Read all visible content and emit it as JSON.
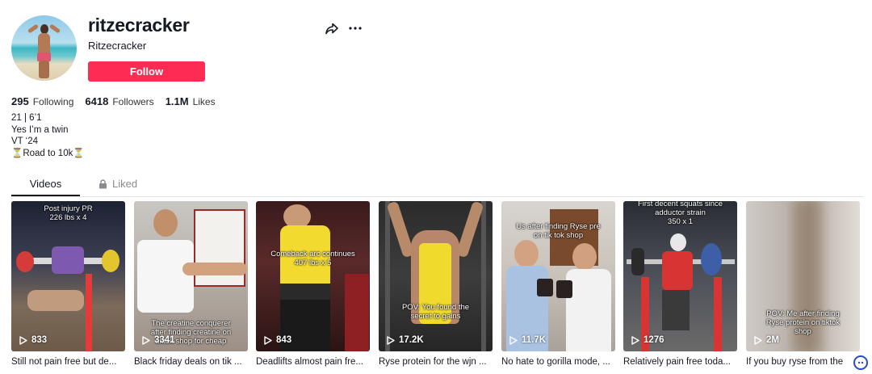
{
  "profile": {
    "username": "ritzecracker",
    "nickname": "Ritzecracker",
    "follow_label": "Follow"
  },
  "stats": {
    "following_count": "295",
    "following_label": "Following",
    "followers_count": "6418",
    "followers_label": "Followers",
    "likes_count": "1.1M",
    "likes_label": "Likes"
  },
  "bio": {
    "lines": [
      "21 | 6’1",
      "Yes I’m a twin",
      "VT ‘24",
      "⏳Road to 10k⏳"
    ]
  },
  "tabs": {
    "videos_label": "Videos",
    "liked_label": "Liked"
  },
  "videos": [
    {
      "overlay_top": "Post injury PR\n226 lbs x 4",
      "overlay_mid": "",
      "views": "833",
      "caption": "Still not pain free but de..."
    },
    {
      "overlay_top": "",
      "overlay_mid": "The creatine conquerer\nafter finding creatine on\ntiktok shop for cheap",
      "views": "3341",
      "caption": "Black friday deals on tik ..."
    },
    {
      "overlay_top": "",
      "overlay_mid": "Comeback arc continues\n407 lbs x 5",
      "views": "843",
      "caption": "Deadlifts almost pain fre..."
    },
    {
      "overlay_top": "",
      "overlay_mid": "POV: You found the\nsecret to gains",
      "views": "17.2K",
      "caption": "Ryse protein for the wjn ..."
    },
    {
      "overlay_top": "Us after finding Ryse pre\non tik tok shop",
      "overlay_mid": "",
      "views": "11.7K",
      "caption": "No hate to gorilla mode, ..."
    },
    {
      "overlay_top": "First decent squats since\nadductor strain\n350 x 1",
      "overlay_mid": "",
      "views": "1276",
      "caption": "Relatively pain free toda..."
    },
    {
      "overlay_top": "",
      "overlay_mid": "POV: Me after finding\nRyse protein on tiktok\nshop",
      "views": "2M",
      "caption": "If you buy ryse from the"
    }
  ],
  "colors": {
    "brand": "#fe2c55",
    "text": "#161823",
    "muted": "#8a8b91"
  },
  "icons": [
    "share-icon",
    "more-icon",
    "lock-icon",
    "play-icon"
  ]
}
